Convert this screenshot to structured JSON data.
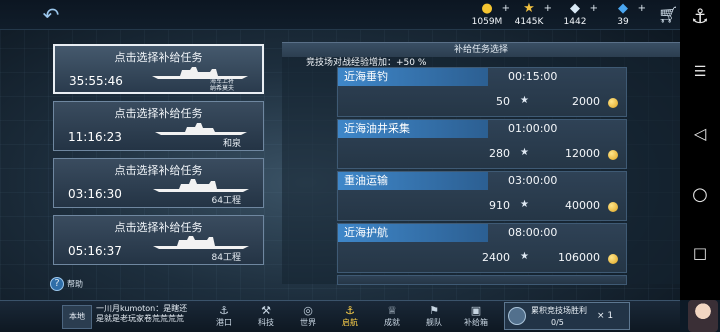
{
  "topbar": {
    "resources": [
      {
        "icon": "gold-coin-icon",
        "value": "1059M"
      },
      {
        "icon": "medal-star-icon",
        "value": "4145K"
      },
      {
        "icon": "diamond-icon",
        "value": "1442"
      },
      {
        "icon": "blue-gem-icon",
        "value": "39"
      }
    ],
    "plus": "+"
  },
  "missions": [
    {
      "title": "点击选择补给任务",
      "time": "35:55:46",
      "ship_name": "海军上将纳希莫夫",
      "selected": true
    },
    {
      "title": "点击选择补给任务",
      "time": "11:16:23",
      "ship_name": "和泉",
      "selected": false
    },
    {
      "title": "点击选择补给任务",
      "time": "03:16:30",
      "ship_name": "64工程",
      "selected": false
    },
    {
      "title": "点击选择补给任务",
      "time": "05:16:37",
      "ship_name": "84工程",
      "selected": false
    }
  ],
  "help": {
    "label": "帮助"
  },
  "panel": {
    "title": "补给任务选择",
    "bonus": "竞技场对战经验增加：+50 %",
    "tasks": [
      {
        "name": "近海垂钓",
        "duration": "00:15:00",
        "exp": "50",
        "gold": "2000"
      },
      {
        "name": "近海油井采集",
        "duration": "01:00:00",
        "exp": "280",
        "gold": "12000"
      },
      {
        "name": "重油运输",
        "duration": "03:00:00",
        "exp": "910",
        "gold": "40000"
      },
      {
        "name": "近海护航",
        "duration": "08:00:00",
        "exp": "2400",
        "gold": "106000"
      }
    ]
  },
  "bottombar": {
    "home_label": "本地",
    "ticker": "一川月kumoton：是瞎还是就是老玩家卷荒荒荒荒",
    "nav": [
      {
        "label": "港口",
        "icon": "port-icon",
        "active": false
      },
      {
        "label": "科技",
        "icon": "tech-icon",
        "active": false
      },
      {
        "label": "世界",
        "icon": "globe-icon",
        "active": false
      },
      {
        "label": "启航",
        "icon": "anchor-icon",
        "active": true
      },
      {
        "label": "成就",
        "icon": "trophy-icon",
        "active": false
      },
      {
        "label": "舰队",
        "icon": "fleet-icon",
        "active": false
      },
      {
        "label": "补给箱",
        "icon": "supply-box-icon",
        "active": false
      }
    ],
    "quest": {
      "title": "累积竞技场胜利",
      "progress": "0/5",
      "reward": "× 1"
    }
  }
}
